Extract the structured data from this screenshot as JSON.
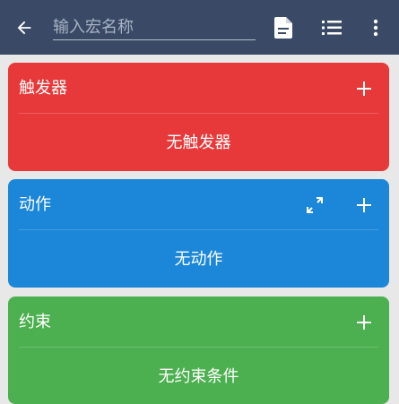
{
  "appbar": {
    "back_icon": "arrow-left-icon",
    "name_placeholder": "输入宏名称",
    "actions": [
      "file-document-icon",
      "list-icon",
      "more-vertical-icon"
    ],
    "background": "#3a4a66"
  },
  "cards": {
    "triggers": {
      "title": "触发器",
      "empty_text": "无触发器",
      "color": "#e8393a",
      "icons": [
        "plus-icon"
      ]
    },
    "actions": {
      "title": "动作",
      "empty_text": "无动作",
      "color": "#1c87d8",
      "icons": [
        "expand-icon",
        "plus-icon"
      ]
    },
    "constraints": {
      "title": "约束",
      "empty_text": "无约束条件",
      "color": "#4caf50",
      "icons": [
        "plus-icon"
      ]
    }
  }
}
